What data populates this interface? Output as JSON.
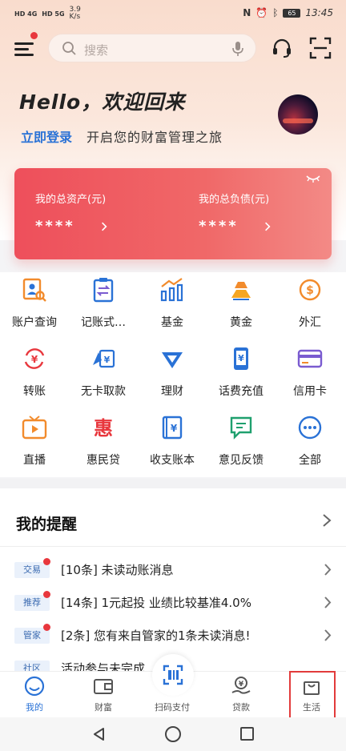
{
  "status_bar": {
    "left_net_1": "HD 4G",
    "left_net_2": "HD 5G",
    "speed_value": "3.9",
    "speed_unit": "K/s",
    "battery": "65",
    "time": "13:45"
  },
  "header": {
    "search_placeholder": "搜索"
  },
  "greeting": {
    "hello": "Hello，欢迎回来",
    "login_link": "立即登录",
    "login_sub": "开启您的财富管理之旅"
  },
  "asset_card": {
    "total_assets_label": "我的总资产(元)",
    "total_assets_value": "****",
    "total_liabilities_label": "我的总负债(元)",
    "total_liabilities_value": "****"
  },
  "grid": [
    {
      "label": "账户查询",
      "icon": "account-query-icon"
    },
    {
      "label": "记账式…",
      "icon": "bookkeeping-icon"
    },
    {
      "label": "基金",
      "icon": "fund-icon"
    },
    {
      "label": "黄金",
      "icon": "gold-icon"
    },
    {
      "label": "外汇",
      "icon": "forex-icon"
    },
    {
      "label": "转账",
      "icon": "transfer-icon"
    },
    {
      "label": "无卡取款",
      "icon": "cardless-withdraw-icon"
    },
    {
      "label": "理财",
      "icon": "wealth-icon"
    },
    {
      "label": "话费充值",
      "icon": "phone-recharge-icon"
    },
    {
      "label": "信用卡",
      "icon": "credit-card-icon"
    },
    {
      "label": "直播",
      "icon": "live-tv-icon"
    },
    {
      "label": "惠民贷",
      "icon": "loan-icon"
    },
    {
      "label": "收支账本",
      "icon": "ledger-icon"
    },
    {
      "label": "意见反馈",
      "icon": "feedback-icon"
    },
    {
      "label": "全部",
      "icon": "more-icon"
    }
  ],
  "reminders": {
    "title": "我的提醒",
    "items": [
      {
        "tag": "交易",
        "text": "[10条] 未读动账消息"
      },
      {
        "tag": "推荐",
        "text": "[14条] 1元起投 业绩比较基准4.0%"
      },
      {
        "tag": "管家",
        "text": "[2条] 您有来自管家的1条未读消息!"
      },
      {
        "tag": "社区",
        "text": "活动参与未完成"
      }
    ]
  },
  "tabbar": {
    "tabs": [
      {
        "label": "我的"
      },
      {
        "label": "财富"
      },
      {
        "label": "扫码支付"
      },
      {
        "label": "贷款"
      },
      {
        "label": "生活"
      }
    ]
  },
  "colors": {
    "brand_blue": "#2a72d6",
    "card_red": "#ee4f5b",
    "highlight_box": "#e23b3b"
  }
}
